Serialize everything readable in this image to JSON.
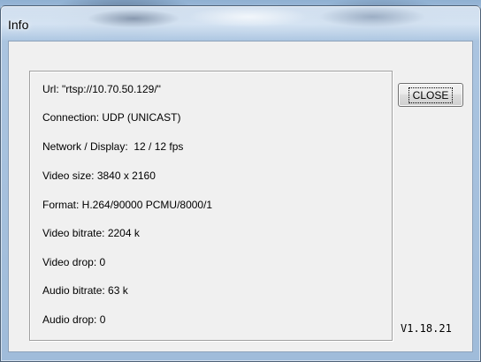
{
  "window": {
    "title": "Info"
  },
  "info": {
    "lines": [
      "Url: \"rtsp://10.70.50.129/\"",
      "Connection: UDP (UNICAST)",
      "Network / Display:  12 / 12 fps",
      "Video size: 3840 x 2160",
      "Format: H.264/90000 PCMU/8000/1",
      "Video bitrate: 2204 k",
      "Video drop: 0",
      "Audio bitrate: 63 k",
      "Audio drop: 0"
    ]
  },
  "buttons": {
    "close_label": "CLOSE"
  },
  "version": "V1.18.21",
  "colors": {
    "client_background": "#f0f0f0",
    "title_bar_glass": "#bcd2ea",
    "group_border": "#a0a0a0"
  }
}
